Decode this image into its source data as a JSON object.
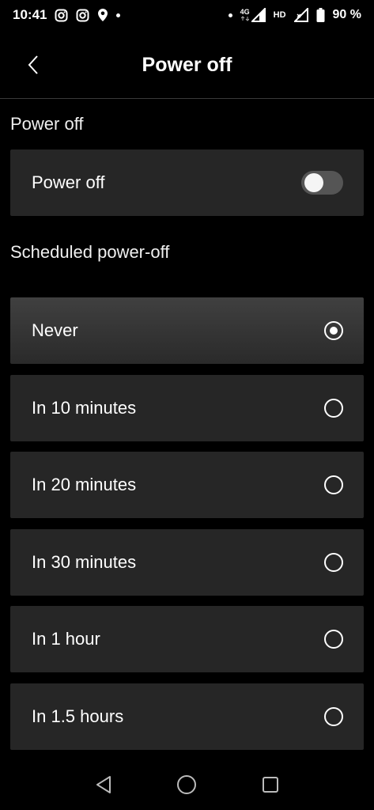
{
  "status_bar": {
    "time": "10:41",
    "network_type": "4G",
    "signal_label": "HD",
    "battery_percent": "90 %",
    "icons": [
      "instagram-icon",
      "instagram-icon",
      "location-icon",
      "dot-icon",
      "dot-icon",
      "signal-icon",
      "signal-icon",
      "battery-icon"
    ]
  },
  "header": {
    "title": "Power off"
  },
  "sections": {
    "power_off_title": "Power off",
    "power_off_toggle": {
      "label": "Power off",
      "state": "off"
    },
    "scheduled_title": "Scheduled power-off"
  },
  "options": [
    {
      "label": "Never",
      "selected": true
    },
    {
      "label": "In 10 minutes",
      "selected": false
    },
    {
      "label": "In 20 minutes",
      "selected": false
    },
    {
      "label": "In 30 minutes",
      "selected": false
    },
    {
      "label": "In 1 hour",
      "selected": false
    },
    {
      "label": "In 1.5 hours",
      "selected": false
    }
  ],
  "nav_bar": {
    "icons": [
      "back-triangle-icon",
      "home-circle-icon",
      "recents-square-icon"
    ]
  }
}
